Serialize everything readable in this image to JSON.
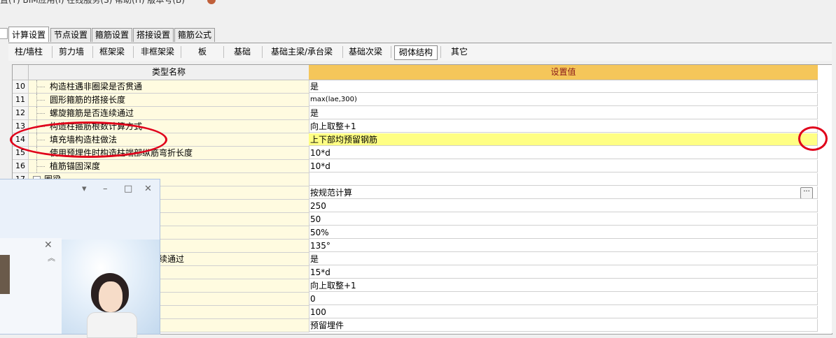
{
  "menubar": {
    "partial_text": "置(Y)  BIM应用(I)  在线服务(S)  帮助(H)  版本号(B)"
  },
  "tabs_top": [
    {
      "label": "计算设置",
      "active": true
    },
    {
      "label": "节点设置",
      "active": false
    },
    {
      "label": "箍筋设置",
      "active": false
    },
    {
      "label": "搭接设置",
      "active": false
    },
    {
      "label": "箍筋公式",
      "active": false
    }
  ],
  "tabs_sub": [
    {
      "label": "柱/墙柱",
      "active": false
    },
    {
      "label": "剪力墙",
      "active": false
    },
    {
      "label": "框架梁",
      "active": false
    },
    {
      "label": "非框架梁",
      "active": false
    },
    {
      "label": "板",
      "active": false
    },
    {
      "label": "基础",
      "active": false
    },
    {
      "label": "基础主梁/承台梁",
      "active": false
    },
    {
      "label": "基础次梁",
      "active": false
    },
    {
      "label": "砌体结构",
      "active": true
    },
    {
      "label": "其它",
      "active": false
    }
  ],
  "grid": {
    "header_name": "类型名称",
    "header_value": "设置值",
    "rows": [
      {
        "num": "10",
        "name": "构造柱遇非圈梁是否贯通",
        "value": "是"
      },
      {
        "num": "11",
        "name": "圆形箍筋的搭接长度",
        "value": "max(lae,300)"
      },
      {
        "num": "12",
        "name": "螺旋箍筋是否连续通过",
        "value": "是"
      },
      {
        "num": "13",
        "name": "构造柱箍筋根数计算方式",
        "value": "向上取整+1"
      },
      {
        "num": "14",
        "name": "填充墙构造柱做法",
        "value": "上下部均预留钢筋"
      },
      {
        "num": "15",
        "name": "使用预埋件时构造柱端部纵筋弯折长度",
        "value": "10*d"
      },
      {
        "num": "16",
        "name": "植筋锚固深度",
        "value": "10*d"
      },
      {
        "num": "17",
        "name": "圈梁",
        "value": ""
      },
      {
        "num": "",
        "name": "",
        "value": "按规范计算"
      },
      {
        "num": "",
        "name": "",
        "value": "250"
      },
      {
        "num": "",
        "name": "",
        "value": "50"
      },
      {
        "num": "",
        "name": "",
        "value": "50%"
      },
      {
        "num": "",
        "name": "",
        "value": "135°"
      },
      {
        "num": "",
        "name": "续通过",
        "value": "是"
      },
      {
        "num": "",
        "name": "",
        "value": "15*d"
      },
      {
        "num": "",
        "name": "",
        "value": "向上取整+1"
      },
      {
        "num": "",
        "name": "",
        "value": "0"
      },
      {
        "num": "",
        "name": "",
        "value": "100"
      },
      {
        "num": "",
        "name": "",
        "value": "预留埋件"
      }
    ]
  },
  "popup": {
    "controls": [
      "▾",
      "–",
      "□",
      "✕"
    ],
    "inner_close": "✕",
    "collapse": "︽"
  }
}
